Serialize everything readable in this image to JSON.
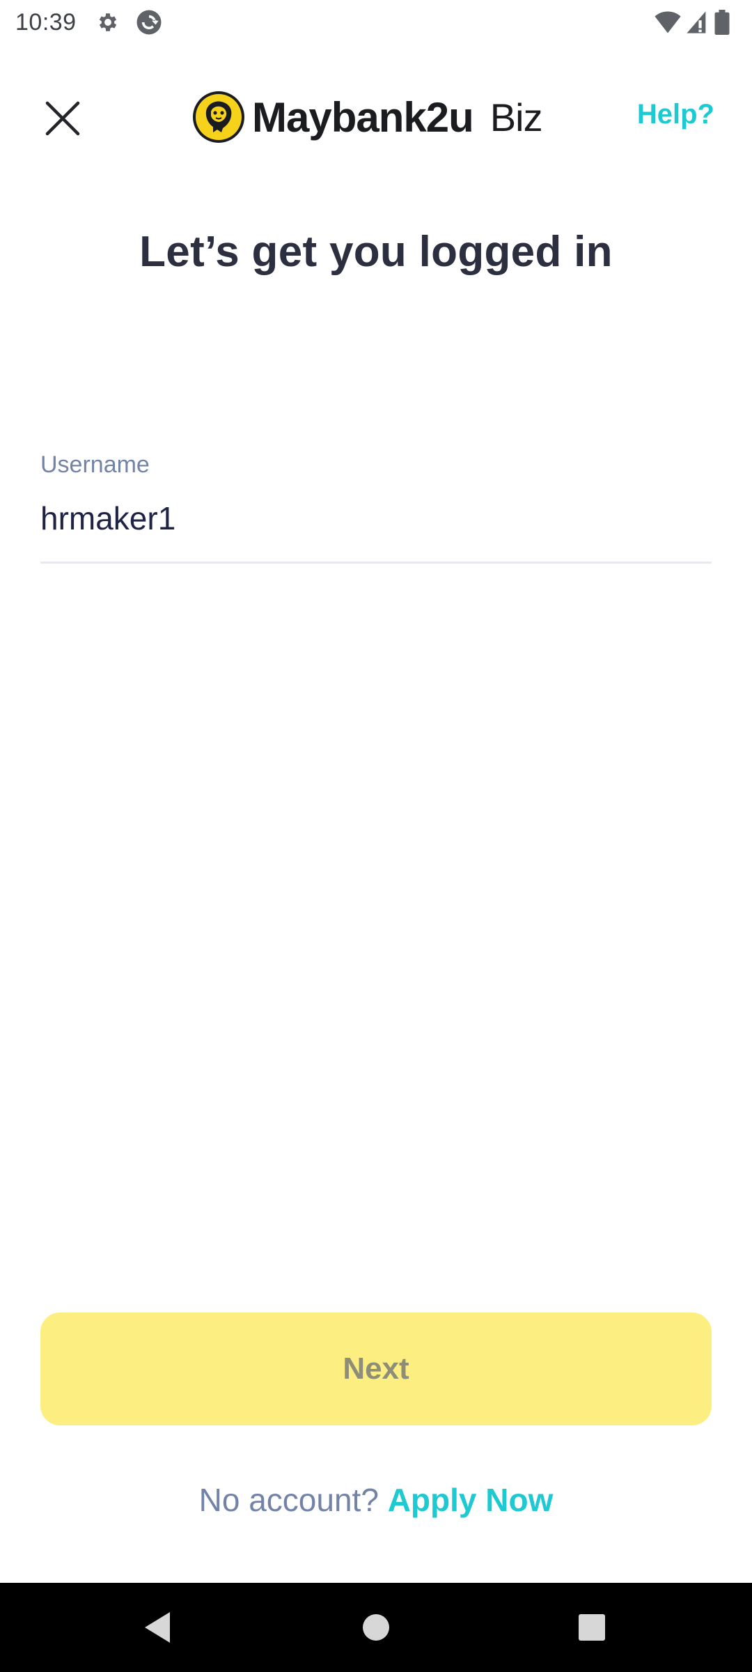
{
  "status_bar": {
    "time": "10:39",
    "icons_left": [
      "gear-icon",
      "sync-icon"
    ],
    "icons_right": [
      "wifi-icon",
      "cellular-signal-icon",
      "battery-icon"
    ]
  },
  "header": {
    "close_icon": "close-icon",
    "brand_logo": "maybank-tiger-logo",
    "brand_name": "Maybank2u",
    "brand_suffix": "Biz",
    "help_label": "Help?"
  },
  "title": "Let’s get you logged in",
  "username_field": {
    "label": "Username",
    "value": "hrmaker1"
  },
  "next_button": {
    "label": "Next",
    "enabled": false
  },
  "footer": {
    "prompt": "No account?",
    "link_label": "Apply Now"
  },
  "nav_bar": {
    "back_icon": "back-triangle-icon",
    "home_icon": "home-circle-icon",
    "recents_icon": "recents-square-icon"
  },
  "colors": {
    "accent": "#1fc9d2",
    "button_disabled_bg": "#fdee82",
    "title_text": "#2b2f3f",
    "label_text": "#7383a8",
    "logo_yellow": "#f7d21b"
  }
}
